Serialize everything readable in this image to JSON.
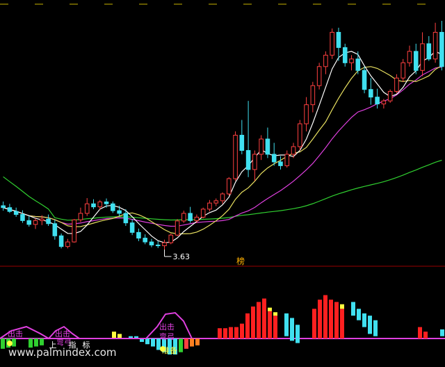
{
  "chart_data": [
    {
      "type": "candlestick",
      "title": "",
      "xlabel": "",
      "ylabel": "",
      "ylim": [
        3.4,
        9.6
      ],
      "grid": false,
      "colors": {
        "up": "#ff4040",
        "down": "#40e0f0",
        "ma_short": "#ffffff",
        "ma_mid": "#e8e060",
        "ma_long": "#e040e0",
        "ma_longest": "#30d030"
      },
      "candles": [
        [
          4.75,
          4.86,
          4.62,
          4.7
        ],
        [
          4.7,
          4.8,
          4.56,
          4.6
        ],
        [
          4.6,
          4.7,
          4.46,
          4.52
        ],
        [
          4.52,
          4.63,
          4.3,
          4.36
        ],
        [
          4.36,
          4.48,
          4.2,
          4.26
        ],
        [
          4.26,
          4.42,
          4.14,
          4.36
        ],
        [
          4.36,
          4.5,
          4.24,
          4.4
        ],
        [
          4.4,
          4.52,
          4.22,
          4.28
        ],
        [
          4.28,
          4.38,
          3.86,
          3.96
        ],
        [
          3.96,
          4.02,
          3.63,
          3.68
        ],
        [
          3.68,
          3.88,
          3.63,
          3.8
        ],
        [
          3.8,
          4.4,
          3.78,
          4.38
        ],
        [
          4.38,
          4.7,
          4.32,
          4.55
        ],
        [
          4.55,
          4.95,
          4.48,
          4.8
        ],
        [
          4.8,
          4.92,
          4.66,
          4.72
        ],
        [
          4.72,
          4.9,
          4.64,
          4.85
        ],
        [
          4.85,
          4.94,
          4.7,
          4.8
        ],
        [
          4.8,
          4.86,
          4.56,
          4.62
        ],
        [
          4.62,
          4.75,
          4.48,
          4.55
        ],
        [
          4.55,
          4.66,
          4.22,
          4.3
        ],
        [
          4.3,
          4.4,
          3.98,
          4.05
        ],
        [
          4.05,
          4.15,
          3.82,
          3.9
        ],
        [
          3.9,
          4.0,
          3.74,
          3.8
        ],
        [
          3.8,
          3.88,
          3.66,
          3.72
        ],
        [
          3.72,
          3.82,
          3.64,
          3.7
        ],
        [
          3.7,
          3.86,
          3.6,
          3.78
        ],
        [
          3.78,
          4.02,
          3.74,
          3.98
        ],
        [
          3.98,
          4.4,
          3.95,
          4.35
        ],
        [
          4.35,
          4.62,
          4.3,
          4.55
        ],
        [
          4.55,
          4.72,
          4.3,
          4.36
        ],
        [
          4.36,
          4.52,
          4.3,
          4.45
        ],
        [
          4.45,
          4.7,
          4.42,
          4.66
        ],
        [
          4.66,
          4.9,
          4.6,
          4.82
        ],
        [
          4.82,
          4.94,
          4.74,
          4.88
        ],
        [
          4.88,
          5.1,
          4.8,
          5.06
        ],
        [
          5.06,
          5.5,
          5.02,
          5.46
        ],
        [
          5.46,
          6.7,
          5.4,
          6.6
        ],
        [
          6.6,
          7.0,
          6.1,
          6.2
        ],
        [
          6.2,
          7.5,
          5.5,
          5.7
        ],
        [
          5.7,
          6.2,
          5.4,
          6.1
        ],
        [
          6.1,
          6.6,
          5.95,
          6.5
        ],
        [
          6.5,
          6.8,
          6.0,
          6.1
        ],
        [
          6.1,
          6.4,
          5.8,
          5.9
        ],
        [
          5.9,
          6.05,
          5.7,
          5.8
        ],
        [
          5.8,
          6.2,
          5.75,
          6.1
        ],
        [
          6.1,
          6.4,
          6.0,
          6.3
        ],
        [
          6.3,
          7.0,
          6.2,
          6.9
        ],
        [
          6.9,
          7.6,
          6.7,
          7.4
        ],
        [
          7.4,
          8.0,
          7.2,
          7.9
        ],
        [
          7.9,
          8.5,
          7.8,
          8.4
        ],
        [
          8.4,
          8.8,
          8.2,
          8.7
        ],
        [
          8.7,
          9.4,
          8.6,
          9.3
        ],
        [
          9.3,
          9.42,
          8.55,
          8.9
        ],
        [
          8.9,
          9.0,
          8.4,
          8.5
        ],
        [
          8.5,
          8.7,
          8.3,
          8.6
        ],
        [
          8.6,
          8.8,
          8.2,
          8.3
        ],
        [
          8.3,
          8.4,
          7.7,
          7.8
        ],
        [
          7.8,
          8.1,
          7.4,
          7.6
        ],
        [
          7.6,
          7.82,
          7.3,
          7.42
        ],
        [
          7.42,
          7.55,
          7.3,
          7.5
        ],
        [
          7.5,
          7.8,
          7.45,
          7.75
        ],
        [
          7.75,
          8.2,
          7.7,
          8.1
        ],
        [
          8.1,
          8.6,
          8.0,
          8.5
        ],
        [
          8.5,
          8.95,
          8.4,
          8.8
        ],
        [
          8.8,
          9.0,
          8.2,
          8.3
        ],
        [
          8.3,
          9.3,
          8.15,
          9.0
        ],
        [
          9.0,
          9.2,
          8.55,
          8.6
        ],
        [
          8.6,
          9.55,
          8.5,
          9.3
        ],
        [
          9.3,
          9.6,
          8.3,
          8.4
        ]
      ],
      "annotations": [
        {
          "text": "3.63"
        }
      ],
      "labels": [
        {
          "text": "榜"
        }
      ]
    },
    {
      "type": "bar",
      "title": "",
      "xlabel": "",
      "ylabel": "",
      "ylim": [
        -10,
        28
      ],
      "grid": false,
      "baseline_color": "#e040e0",
      "values": [
        {
          "i": 0,
          "v": -4.5,
          "c": "#30d030"
        },
        {
          "i": 1,
          "v": -4,
          "c": "#30d030"
        },
        {
          "i": 2,
          "v": -3.5,
          "c": "#30d030"
        },
        {
          "i": 5,
          "v": -4,
          "c": "#30d030"
        },
        {
          "i": 6,
          "v": -3.5,
          "c": "#30d030"
        },
        {
          "i": 7,
          "v": -3,
          "c": "#30d030"
        },
        {
          "i": 20,
          "v": 3,
          "c": "#ffff40"
        },
        {
          "i": 21,
          "v": 2,
          "c": "#ffff40"
        },
        {
          "i": 23,
          "v": 1,
          "c": "#40e0f0"
        },
        {
          "i": 24,
          "v": 1,
          "c": "#40e0f0"
        },
        {
          "i": 25,
          "v": -1.5,
          "c": "#40e0f0"
        },
        {
          "i": 26,
          "v": -2.5,
          "c": "#40e0f0"
        },
        {
          "i": 27,
          "v": -3.5,
          "c": "#40e0f0"
        },
        {
          "i": 28,
          "v": -5,
          "c": "#40e0f0"
        },
        {
          "i": 29,
          "v": -6,
          "c": "#40e0f0"
        },
        {
          "i": 30,
          "v": -7,
          "c": "#40e0f0"
        },
        {
          "i": 31,
          "v": -7,
          "c": "#40e0f0"
        },
        {
          "i": 32,
          "v": -6,
          "c": "#30d030"
        },
        {
          "i": 33,
          "v": -4.5,
          "c": "#ff4040"
        },
        {
          "i": 34,
          "v": -3.5,
          "c": "#ff8020"
        },
        {
          "i": 35,
          "v": -3,
          "c": "#ff8020"
        },
        {
          "i": 39,
          "v": 4.5,
          "c": "#ff2020"
        },
        {
          "i": 40,
          "v": 4.5,
          "c": "#ff2020"
        },
        {
          "i": 41,
          "v": 5,
          "c": "#ff2020"
        },
        {
          "i": 42,
          "v": 5,
          "c": "#ff2020"
        },
        {
          "i": 43,
          "v": 6.5,
          "c": "#ff2020"
        },
        {
          "i": 44,
          "v": 11,
          "c": "#ff2020"
        },
        {
          "i": 45,
          "v": 14,
          "c": "#ff2020"
        },
        {
          "i": 46,
          "v": 16,
          "c": "#ff2020"
        },
        {
          "i": 47,
          "v": 17.5,
          "c": "#ff2020"
        },
        {
          "i": 48,
          "v": 12,
          "c": "#ff2020",
          "cap": 1.5
        },
        {
          "i": 49,
          "v": 10,
          "c": "#ff2020",
          "cap": 1.5
        },
        {
          "i": 51,
          "v": 1,
          "c": "#40e0f0",
          "top": 11
        },
        {
          "i": 52,
          "v": -1,
          "c": "#40e0f0",
          "top": 9
        },
        {
          "i": 53,
          "v": -2,
          "c": "#40e0f0",
          "top": 6
        },
        {
          "i": 56,
          "v": 13,
          "c": "#ff2020"
        },
        {
          "i": 57,
          "v": 17,
          "c": "#ff2020"
        },
        {
          "i": 58,
          "v": 19,
          "c": "#ff2020"
        },
        {
          "i": 59,
          "v": 17,
          "c": "#ff2020"
        },
        {
          "i": 60,
          "v": 16,
          "c": "#ff2020"
        },
        {
          "i": 61,
          "v": 13,
          "c": "#ff2020",
          "cap": 2
        },
        {
          "i": 63,
          "v": 10,
          "c": "#40e0f0",
          "top": 16
        },
        {
          "i": 64,
          "v": 8,
          "c": "#40e0f0",
          "top": 13
        },
        {
          "i": 65,
          "v": 5,
          "c": "#40e0f0",
          "top": 11
        },
        {
          "i": 66,
          "v": 2,
          "c": "#40e0f0",
          "top": 10
        },
        {
          "i": 67,
          "v": 1,
          "c": "#40e0f0",
          "top": 8
        },
        {
          "i": 75,
          "v": 5,
          "c": "#ff2020"
        },
        {
          "i": 76,
          "v": 3,
          "c": "#ff2020"
        },
        {
          "i": 79,
          "v": 1,
          "c": "#40e0f0",
          "top": 4
        }
      ],
      "annotations": [
        {
          "text": "出击",
          "color": "#e040e0"
        },
        {
          "text": "出击",
          "color": "#e040e0"
        },
        {
          "text": "出击",
          "color": "#e040e0"
        },
        {
          "text": "弯弓",
          "color": "#e040e0"
        },
        {
          "text": "弯弓",
          "color": "#e040e0"
        },
        {
          "text": "上",
          "color": "#ffffff"
        },
        {
          "text": "指",
          "color": "#ffffff"
        },
        {
          "text": "标",
          "color": "#ffffff"
        },
        {
          "text": "准备",
          "color": "#ffff40"
        }
      ]
    }
  ],
  "watermark": "www.palmindex.com"
}
